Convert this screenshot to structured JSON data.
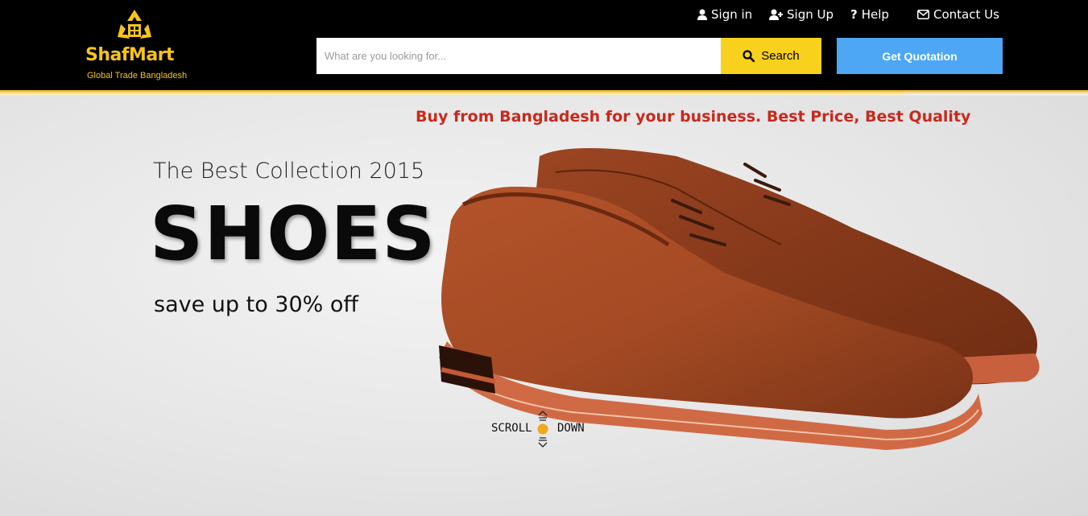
{
  "header": {
    "logo": {
      "name": "ShafMart",
      "tagline": "Global Trade Bangladesh",
      "color": "#f5c518"
    },
    "nav": [
      {
        "label": "Sign in",
        "icon": "user-icon"
      },
      {
        "label": "Sign Up",
        "icon": "user-plus-icon"
      },
      {
        "label": "Help",
        "icon": "question-icon"
      },
      {
        "label": "Contact Us",
        "icon": "envelope-icon"
      }
    ],
    "search": {
      "placeholder": "What are you looking for...",
      "value": "",
      "button_label": "Search",
      "button_color": "#f7d11b"
    },
    "quote_button": {
      "label": "Get Quotation",
      "color": "#4da7f5"
    }
  },
  "hero": {
    "promo": "Buy from Bangladesh for your business. Best Price, Best Quality",
    "subtitle": "The Best Collection 2015",
    "title": "SHOES",
    "offer": "save up to 30% off",
    "scroll": {
      "left": "SCROLL",
      "right": "DOWN"
    }
  }
}
